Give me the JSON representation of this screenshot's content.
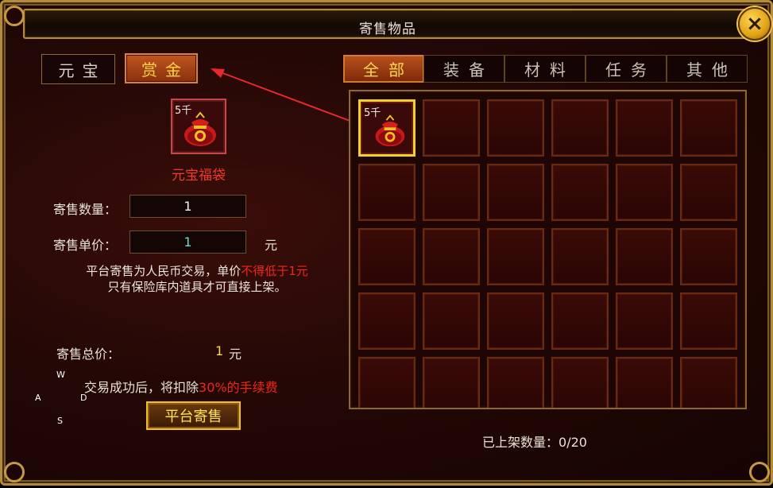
{
  "window": {
    "title": "寄售物品",
    "close_icon": "×"
  },
  "currency_tabs": [
    {
      "label": "元宝",
      "active": false
    },
    {
      "label": "赏金",
      "active": true
    }
  ],
  "category_tabs": [
    {
      "label": "全部",
      "active": true
    },
    {
      "label": "装备",
      "active": false
    },
    {
      "label": "材料",
      "active": false
    },
    {
      "label": "任务",
      "active": false
    },
    {
      "label": "其他",
      "active": false
    }
  ],
  "selected_item": {
    "quantity_tag": "5千",
    "name": "元宝福袋",
    "icon": "lucky-bag-icon"
  },
  "form": {
    "quantity_label": "寄售数量：",
    "quantity_value": "1",
    "price_label": "寄售单价：",
    "price_value": "1",
    "price_unit": "元",
    "notice_line1_a": "平台寄售为人民币交易，单价",
    "notice_line1_b": "不得低于1元",
    "notice_line2": "只有保险库内道具才可直接上架。",
    "total_label": "寄售总价：",
    "total_value": "1",
    "total_unit": "元",
    "fee_a": "交易成功后，将扣除",
    "fee_b": "30%的手续费"
  },
  "keys": {
    "w": "W",
    "a": "A",
    "s": "S",
    "d": "D"
  },
  "sell_button": "平台寄售",
  "inventory": {
    "slot_1_tag": "5千"
  },
  "listed_count": "已上架数量：0/20",
  "colors": {
    "accent_gold": "#ffd84a",
    "warning_red": "#f0261a",
    "frame_gold": "#b58a3a"
  }
}
